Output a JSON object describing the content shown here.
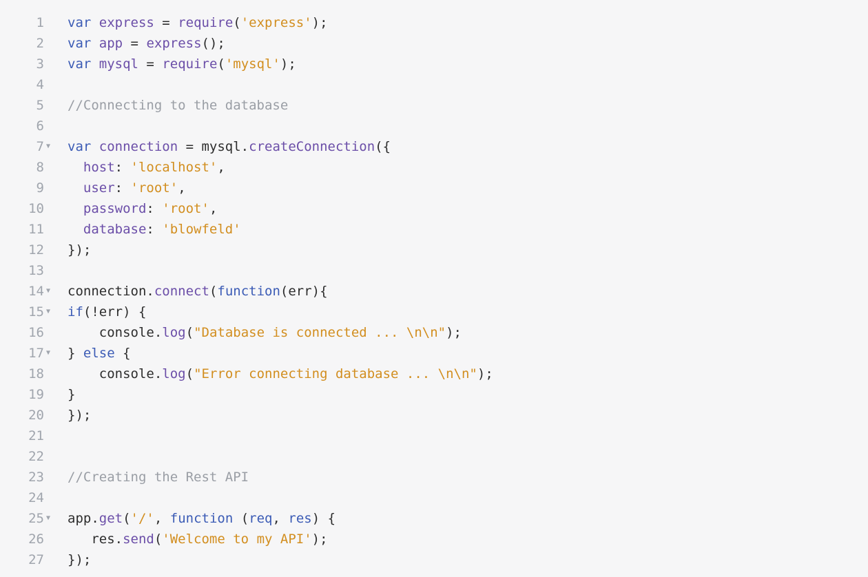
{
  "lines": [
    {
      "num": "1",
      "fold": false,
      "tokens": [
        [
          "kw",
          "var"
        ],
        [
          "plain",
          " "
        ],
        [
          "ident-decl",
          "express"
        ],
        [
          "plain",
          " = "
        ],
        [
          "method",
          "require"
        ],
        [
          "plain",
          "("
        ],
        [
          "str",
          "'express'"
        ],
        [
          "plain",
          ");"
        ]
      ]
    },
    {
      "num": "2",
      "fold": false,
      "tokens": [
        [
          "kw",
          "var"
        ],
        [
          "plain",
          " "
        ],
        [
          "ident-decl",
          "app"
        ],
        [
          "plain",
          " = "
        ],
        [
          "method",
          "express"
        ],
        [
          "plain",
          "();"
        ]
      ]
    },
    {
      "num": "3",
      "fold": false,
      "tokens": [
        [
          "kw",
          "var"
        ],
        [
          "plain",
          " "
        ],
        [
          "ident-decl",
          "mysql"
        ],
        [
          "plain",
          " = "
        ],
        [
          "method",
          "require"
        ],
        [
          "plain",
          "("
        ],
        [
          "str",
          "'mysql'"
        ],
        [
          "plain",
          ");"
        ]
      ]
    },
    {
      "num": "4",
      "fold": false,
      "tokens": []
    },
    {
      "num": "5",
      "fold": false,
      "tokens": [
        [
          "comment",
          "//Connecting to the database"
        ]
      ]
    },
    {
      "num": "6",
      "fold": false,
      "tokens": []
    },
    {
      "num": "7",
      "fold": true,
      "tokens": [
        [
          "kw",
          "var"
        ],
        [
          "plain",
          " "
        ],
        [
          "ident-decl",
          "connection"
        ],
        [
          "plain",
          " = mysql."
        ],
        [
          "method",
          "createConnection"
        ],
        [
          "plain",
          "({"
        ]
      ]
    },
    {
      "num": "8",
      "fold": false,
      "tokens": [
        [
          "plain",
          "  "
        ],
        [
          "prop",
          "host"
        ],
        [
          "plain",
          ": "
        ],
        [
          "str",
          "'localhost'"
        ],
        [
          "plain",
          ","
        ]
      ]
    },
    {
      "num": "9",
      "fold": false,
      "tokens": [
        [
          "plain",
          "  "
        ],
        [
          "prop",
          "user"
        ],
        [
          "plain",
          ": "
        ],
        [
          "str",
          "'root'"
        ],
        [
          "plain",
          ","
        ]
      ]
    },
    {
      "num": "10",
      "fold": false,
      "tokens": [
        [
          "plain",
          "  "
        ],
        [
          "prop",
          "password"
        ],
        [
          "plain",
          ": "
        ],
        [
          "str",
          "'root'"
        ],
        [
          "plain",
          ","
        ]
      ]
    },
    {
      "num": "11",
      "fold": false,
      "tokens": [
        [
          "plain",
          "  "
        ],
        [
          "prop",
          "database"
        ],
        [
          "plain",
          ": "
        ],
        [
          "str",
          "'blowfeld'"
        ]
      ]
    },
    {
      "num": "12",
      "fold": false,
      "tokens": [
        [
          "plain",
          "});"
        ]
      ]
    },
    {
      "num": "13",
      "fold": false,
      "tokens": []
    },
    {
      "num": "14",
      "fold": true,
      "tokens": [
        [
          "plain",
          "connection."
        ],
        [
          "method",
          "connect"
        ],
        [
          "plain",
          "("
        ],
        [
          "kw",
          "function"
        ],
        [
          "plain",
          "(err){"
        ]
      ]
    },
    {
      "num": "15",
      "fold": true,
      "tokens": [
        [
          "kw",
          "if"
        ],
        [
          "plain",
          "(!err) {"
        ]
      ]
    },
    {
      "num": "16",
      "fold": false,
      "tokens": [
        [
          "plain",
          "    console."
        ],
        [
          "method",
          "log"
        ],
        [
          "plain",
          "("
        ],
        [
          "str",
          "\"Database is connected ... \\n\\n\""
        ],
        [
          "plain",
          ");"
        ]
      ]
    },
    {
      "num": "17",
      "fold": true,
      "tokens": [
        [
          "plain",
          "} "
        ],
        [
          "kw",
          "else"
        ],
        [
          "plain",
          " {"
        ]
      ]
    },
    {
      "num": "18",
      "fold": false,
      "tokens": [
        [
          "plain",
          "    console."
        ],
        [
          "method",
          "log"
        ],
        [
          "plain",
          "("
        ],
        [
          "str",
          "\"Error connecting database ... \\n\\n\""
        ],
        [
          "plain",
          ");"
        ]
      ]
    },
    {
      "num": "19",
      "fold": false,
      "tokens": [
        [
          "plain",
          "}"
        ]
      ]
    },
    {
      "num": "20",
      "fold": false,
      "tokens": [
        [
          "plain",
          "});"
        ]
      ]
    },
    {
      "num": "21",
      "fold": false,
      "tokens": []
    },
    {
      "num": "22",
      "fold": false,
      "tokens": []
    },
    {
      "num": "23",
      "fold": false,
      "tokens": [
        [
          "comment",
          "//Creating the Rest API"
        ]
      ]
    },
    {
      "num": "24",
      "fold": false,
      "tokens": []
    },
    {
      "num": "25",
      "fold": true,
      "tokens": [
        [
          "plain",
          "app."
        ],
        [
          "method",
          "get"
        ],
        [
          "plain",
          "("
        ],
        [
          "str",
          "'/'"
        ],
        [
          "plain",
          ", "
        ],
        [
          "kw",
          "function"
        ],
        [
          "plain",
          " ("
        ],
        [
          "param",
          "req"
        ],
        [
          "plain",
          ", "
        ],
        [
          "param",
          "res"
        ],
        [
          "plain",
          ") {"
        ]
      ]
    },
    {
      "num": "26",
      "fold": false,
      "tokens": [
        [
          "plain",
          "   res."
        ],
        [
          "method",
          "send"
        ],
        [
          "plain",
          "("
        ],
        [
          "str",
          "'Welcome to my API'"
        ],
        [
          "plain",
          ");"
        ]
      ]
    },
    {
      "num": "27",
      "fold": false,
      "tokens": [
        [
          "plain",
          "});"
        ]
      ]
    }
  ],
  "fold_glyph": "▼"
}
